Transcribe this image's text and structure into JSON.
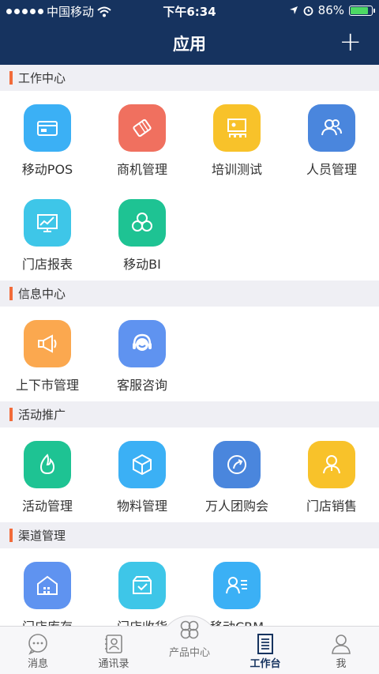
{
  "status": {
    "carrier": "中国移动",
    "time": "下午6:34",
    "battery": "86%"
  },
  "nav": {
    "title": "应用",
    "add_label": "+"
  },
  "sections": [
    {
      "title": "工作中心",
      "items": [
        {
          "label": "移动POS",
          "icon": "card-icon",
          "color": "#3bb0f5"
        },
        {
          "label": "商机管理",
          "icon": "handshake-icon",
          "color": "#f0705f"
        },
        {
          "label": "培训测试",
          "icon": "training-icon",
          "color": "#f8c22a"
        },
        {
          "label": "人员管理",
          "icon": "people-icon",
          "color": "#4a86dd"
        },
        {
          "label": "门店报表",
          "icon": "chart-icon",
          "color": "#3ec6e8"
        },
        {
          "label": "移动BI",
          "icon": "bi-icon",
          "color": "#1ec393"
        }
      ]
    },
    {
      "title": "信息中心",
      "items": [
        {
          "label": "上下市管理",
          "icon": "megaphone-icon",
          "color": "#fba84f"
        },
        {
          "label": "客服咨询",
          "icon": "headset-icon",
          "color": "#5f93f0"
        }
      ]
    },
    {
      "title": "活动推广",
      "items": [
        {
          "label": "活动管理",
          "icon": "flame-icon",
          "color": "#1ec393"
        },
        {
          "label": "物料管理",
          "icon": "box-icon",
          "color": "#3bb0f5"
        },
        {
          "label": "万人团购会",
          "icon": "share-icon",
          "color": "#4a86dd"
        },
        {
          "label": "门店销售",
          "icon": "salesperson-icon",
          "color": "#f8c22a"
        }
      ]
    },
    {
      "title": "渠道管理",
      "items": [
        {
          "label": "门店库存",
          "icon": "warehouse-icon",
          "color": "#5f93f0"
        },
        {
          "label": "门店收货",
          "icon": "receive-icon",
          "color": "#3ec6e8"
        },
        {
          "label": "移动CRM",
          "icon": "crm-icon",
          "color": "#3bb0f5"
        }
      ]
    }
  ],
  "tabbar": {
    "messages": "消息",
    "contacts": "通讯录",
    "products": "产品中心",
    "workbench": "工作台",
    "me": "我"
  }
}
